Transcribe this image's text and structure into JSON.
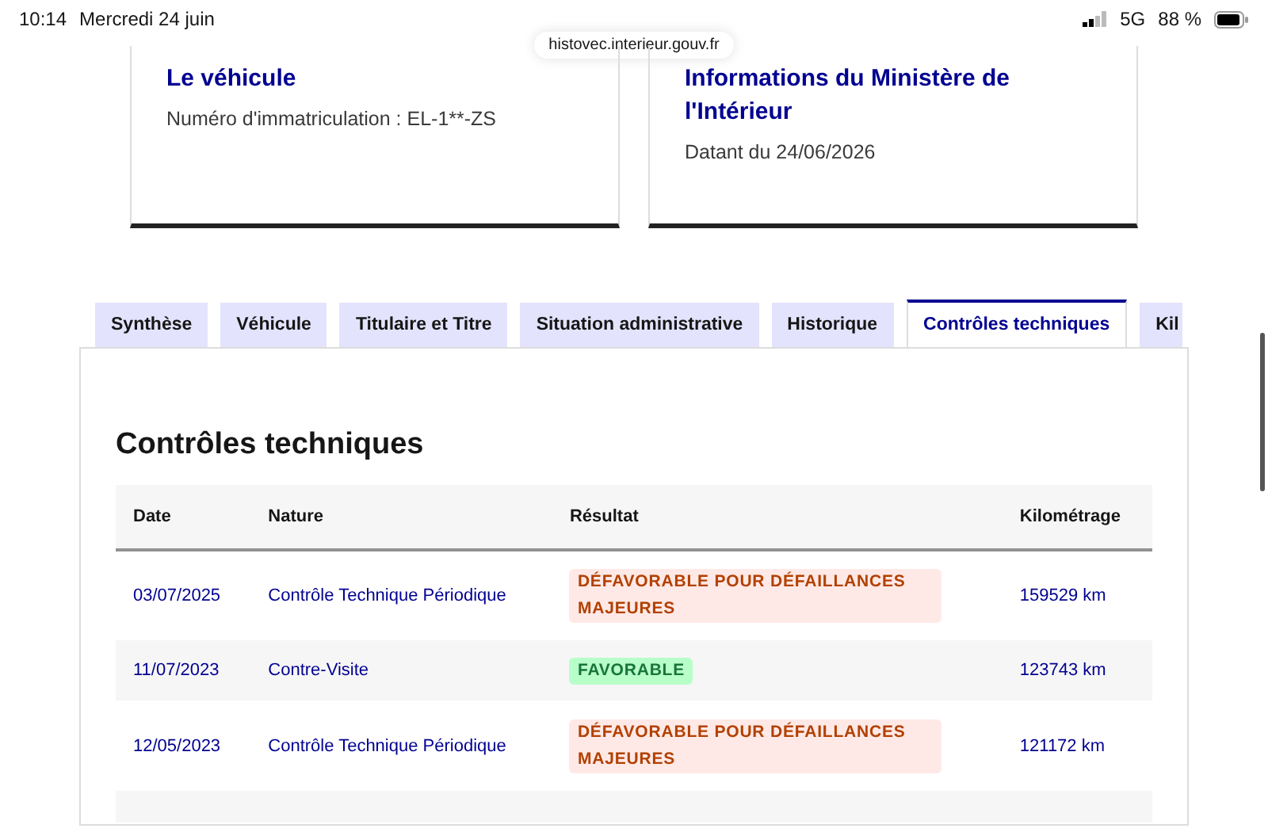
{
  "status_bar": {
    "time": "10:14",
    "date": "Mercredi 24 juin",
    "network": "5G",
    "battery": "88 %"
  },
  "address_bar": {
    "url": "histovec.interieur.gouv.fr"
  },
  "cards": [
    {
      "title": "Le véhicule",
      "text": "Numéro d'immatriculation : EL-1**-ZS"
    },
    {
      "title": "Informations du Ministère de l'Intérieur",
      "text": "Datant du 24/06/2026"
    }
  ],
  "tabs": [
    {
      "label": "Synthèse",
      "selected": false
    },
    {
      "label": "Véhicule",
      "selected": false
    },
    {
      "label": "Titulaire et Titre",
      "selected": false
    },
    {
      "label": "Situation administrative",
      "selected": false
    },
    {
      "label": "Historique",
      "selected": false
    },
    {
      "label": "Contrôles techniques",
      "selected": true
    },
    {
      "label": "Kil",
      "selected": false
    }
  ],
  "section": {
    "title": "Contrôles techniques"
  },
  "table": {
    "columns": [
      "Date",
      "Nature",
      "Résultat",
      "Kilométrage"
    ],
    "rows": [
      {
        "date": "03/07/2025",
        "nature": "Contrôle Technique Périodique",
        "result": "DÉFAVORABLE POUR DÉFAILLANCES MAJEURES",
        "kind": "error",
        "mileage": "159529 km"
      },
      {
        "date": "11/07/2023",
        "nature": "Contre-Visite",
        "result": "FAVORABLE",
        "kind": "success",
        "mileage": "123743 km"
      },
      {
        "date": "12/05/2023",
        "nature": "Contrôle Technique Périodique",
        "result": "DÉFAVORABLE POUR DÉFAILLANCES MAJEURES",
        "kind": "error",
        "mileage": "121172 km"
      }
    ]
  }
}
